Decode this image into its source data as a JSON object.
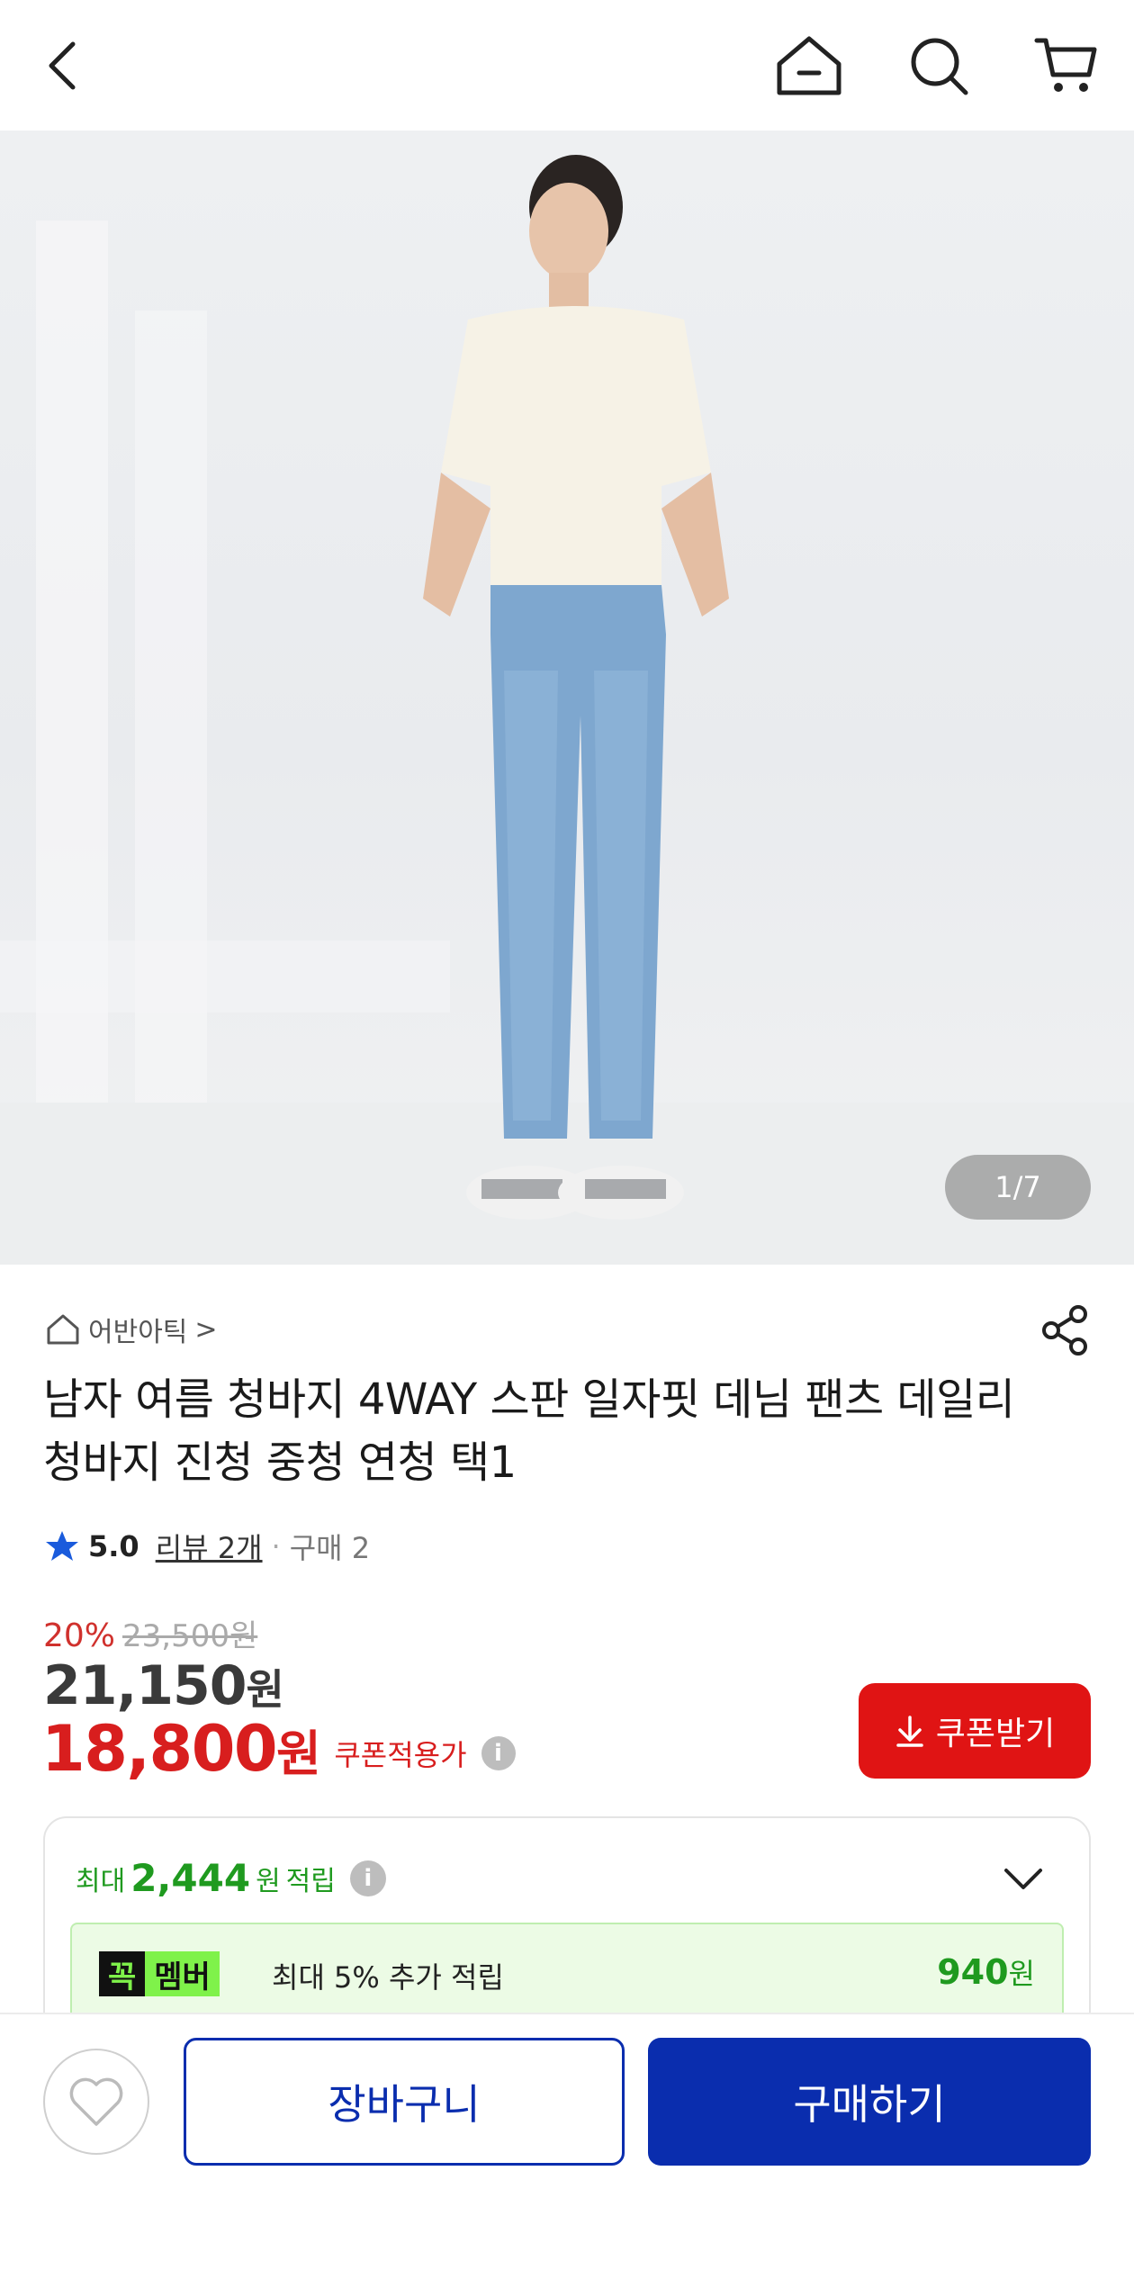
{
  "header": {
    "back_icon": "chevron-left-icon",
    "home_icon": "home-icon",
    "search_icon": "search-icon",
    "cart_icon": "cart-icon"
  },
  "gallery": {
    "counter": "1/7"
  },
  "store": {
    "name": "어반아틱",
    "arrow": ">"
  },
  "product": {
    "title": "남자 여름 청바지 4WAY 스판 일자핏 데님 팬츠 데일리청바지 진청 중청 연청 택1",
    "rating": "5.0",
    "review_link": "리뷰 2개",
    "separator": "·",
    "purchases": "구매 2"
  },
  "pricing": {
    "discount_rate": "20%",
    "original_price": "23,500원",
    "sale_price": "21,150",
    "sale_price_unit": "원",
    "coupon_price": "18,800",
    "coupon_price_unit": "원",
    "coupon_applied_label": "쿠폰적용가",
    "info_symbol": "i",
    "coupon_button": "쿠폰받기"
  },
  "points": {
    "prefix": "최대",
    "amount": "2,444",
    "unit": "원",
    "suffix": "적립",
    "info_symbol": "i"
  },
  "membership": {
    "badge_a": "꼭",
    "badge_b": "멤버",
    "text": "최대 5% 추가 적립",
    "amount": "940",
    "unit": "원"
  },
  "actions": {
    "cart_label": "장바구니",
    "buy_label": "구매하기"
  },
  "colors": {
    "primary": "#0a2dae",
    "sale_red": "#d81e1e",
    "points_green": "#1f9a1f",
    "member_lime": "#7ff24a"
  }
}
